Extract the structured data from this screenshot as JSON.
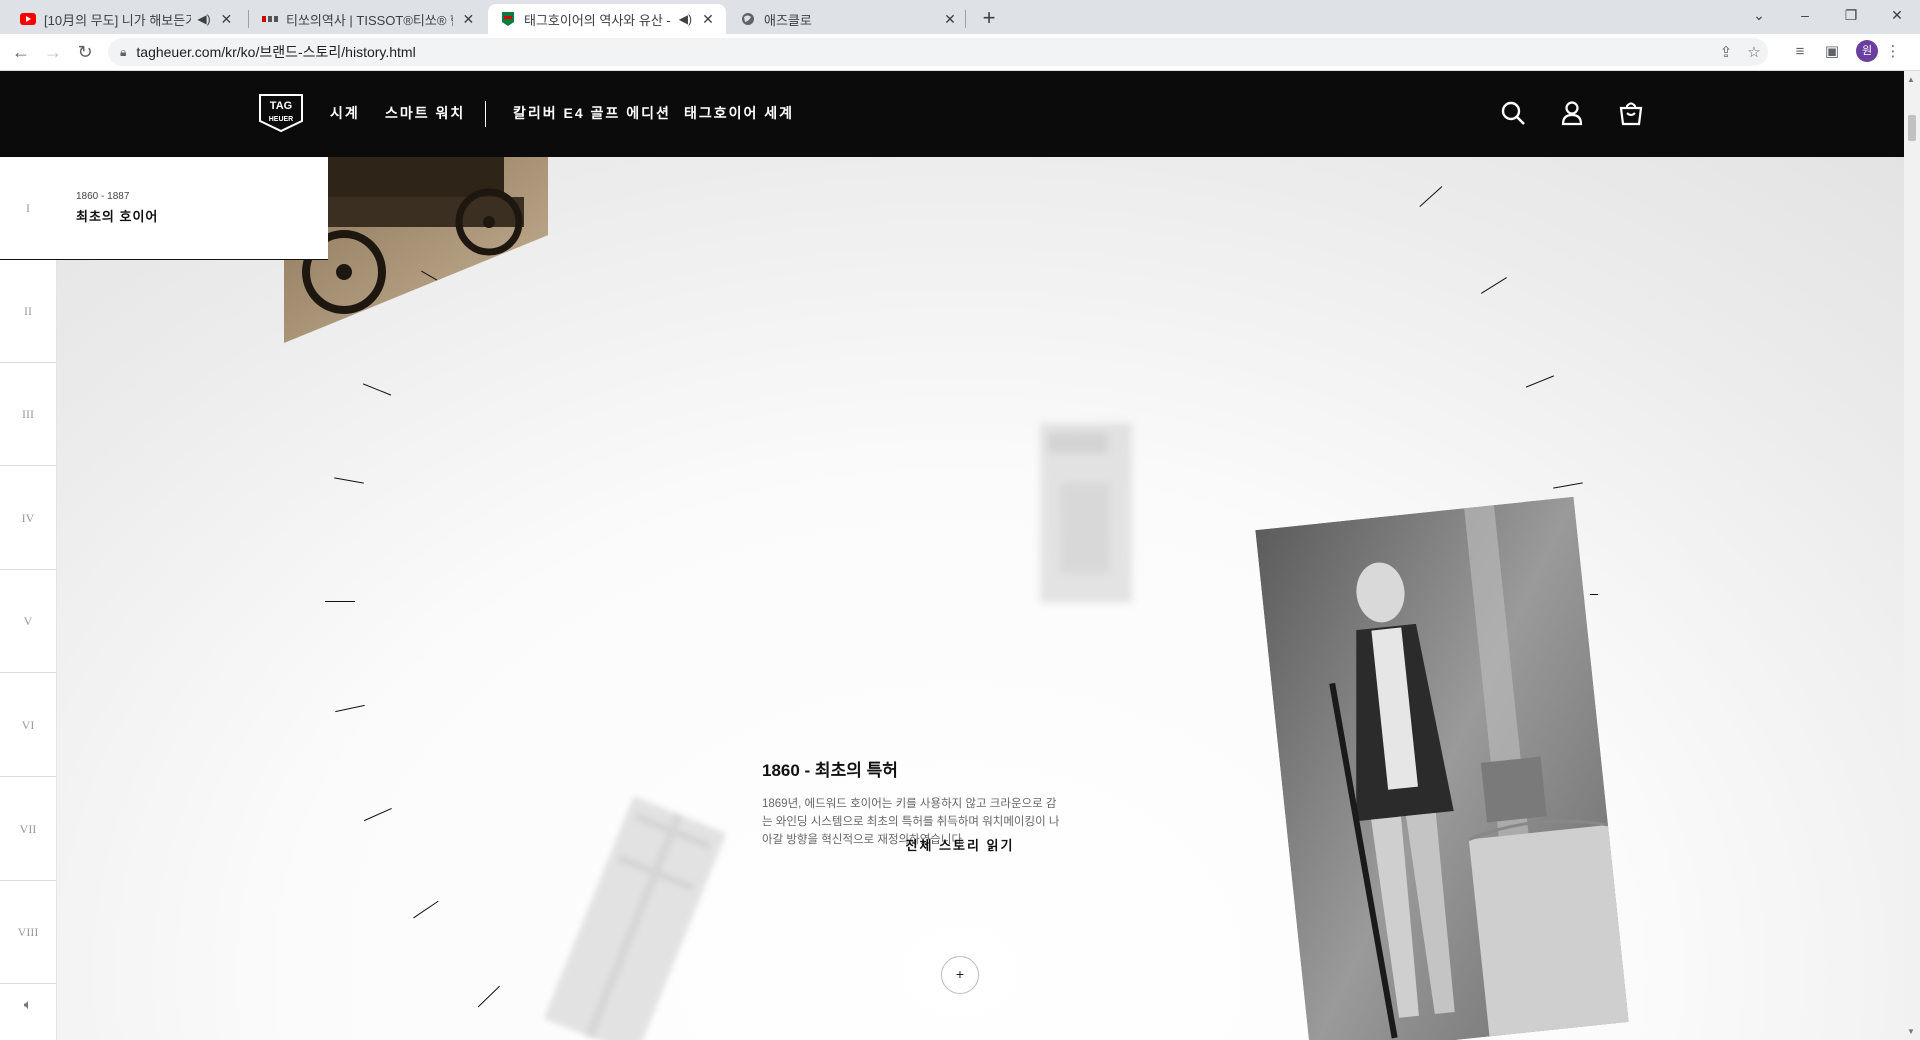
{
  "browser": {
    "tabs": [
      {
        "title": "[10月의 무도] 니가 해보든가",
        "favicon": "youtube-icon",
        "audio": true
      },
      {
        "title": "티쏘의역사 | TISSOT®티쏘® 한",
        "favicon": "tissot-icon",
        "audio": false
      },
      {
        "title": "태그호이어의 역사와 유산 -",
        "favicon": "tagheuer-icon",
        "audio": true,
        "active": true
      },
      {
        "title": "애즈클로",
        "favicon": "globe-icon",
        "audio": false
      }
    ],
    "new_tab": "+",
    "url": "tagheuer.com/kr/ko/브랜드-스토리/history.html",
    "profile_initial": "원"
  },
  "header": {
    "logo_top": "TAG",
    "logo_bottom": "HEUER",
    "nav": [
      "시계",
      "스마트 워치",
      "칼리버 E4 골프 에디션",
      "태그호이어 세계"
    ]
  },
  "sidebar": {
    "active": {
      "numeral": "I",
      "years": "1860 - 1887",
      "title": "최초의 호이어"
    },
    "chapters": [
      "II",
      "III",
      "IV",
      "V",
      "VI",
      "VII",
      "VIII"
    ]
  },
  "story": {
    "heading": "1860 - 최초의 특허",
    "body": "1869년, 에드워드 호이어는 키를 사용하지 않고 크라운으로 감는 와인딩 시스템으로 최초의 특허를 취득하며 워치메이킹이 나아갈 방향을 혁신적으로 재정의하였습니다.",
    "read_more": "전체 스토리 읽기",
    "plus": "+"
  },
  "colors": {
    "header_bg": "#0b0b0b",
    "accent": "#111111"
  }
}
